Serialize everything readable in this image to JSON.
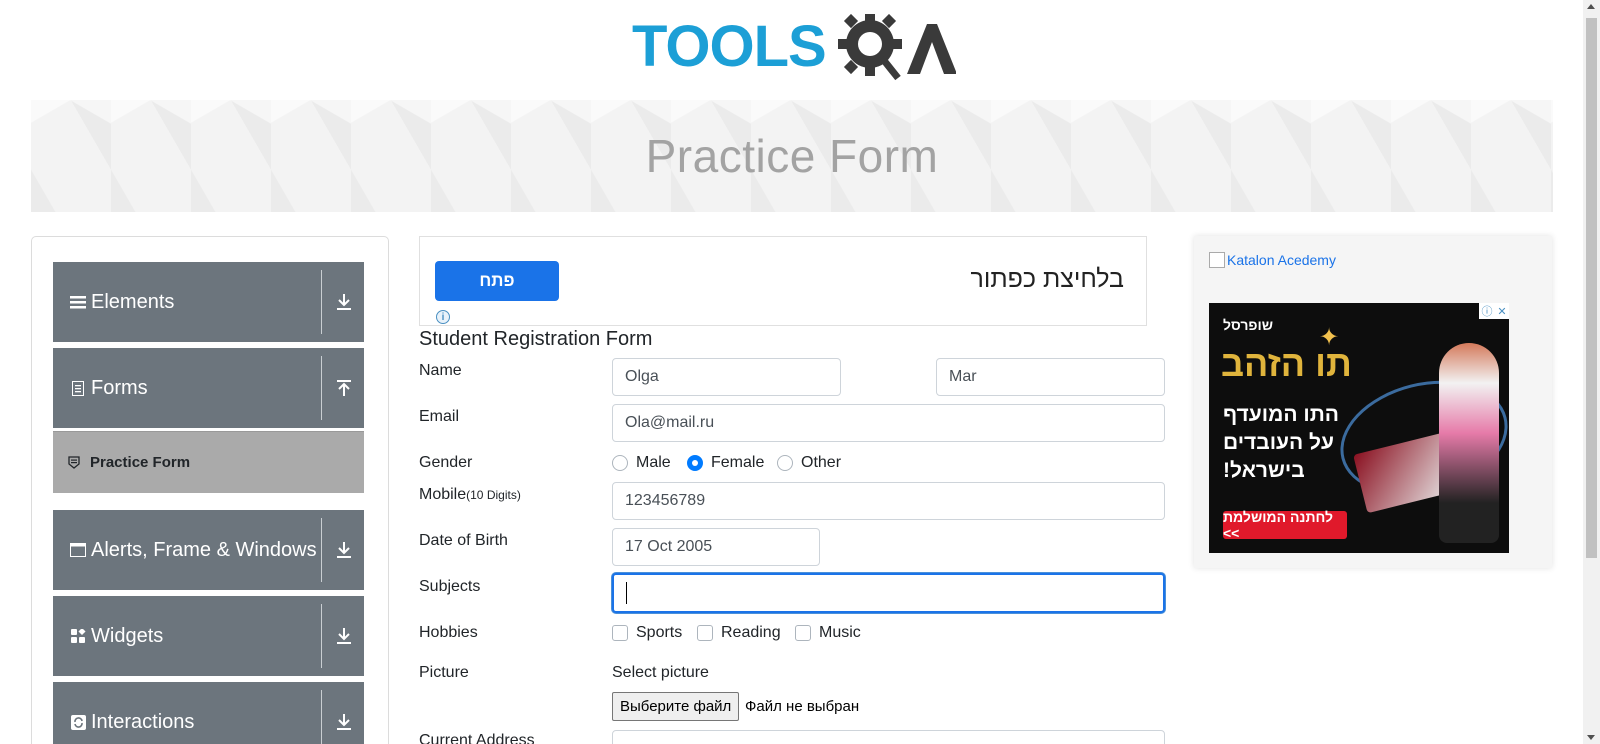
{
  "logo": {
    "part1": "TOOLS",
    "part2": "QA",
    "icon": "gear-magnifier-icon",
    "colors": {
      "primary": "#1c9fd6",
      "secondary": "#3a3a3a"
    }
  },
  "banner": {
    "title": "Practice Form"
  },
  "sidebar": {
    "groups": [
      {
        "label": "Elements",
        "icon": "hamburger-icon",
        "arrow": "download-arrow-icon"
      },
      {
        "label": "Forms",
        "icon": "document-icon",
        "arrow": "upload-arrow-icon"
      },
      {
        "label": "Alerts, Frame & Windows",
        "icon": "window-icon",
        "arrow": "download-arrow-icon"
      },
      {
        "label": "Widgets",
        "icon": "widgets-icon",
        "arrow": "download-arrow-icon"
      },
      {
        "label": "Interactions",
        "icon": "refresh-icon",
        "arrow": "download-arrow-icon"
      }
    ],
    "active_item": {
      "label": "Practice Form",
      "icon": "form-icon"
    },
    "colors": {
      "group_bg": "#6c757d",
      "active_bg": "#aaaaaa"
    }
  },
  "ad_top": {
    "button": "פתח",
    "text": "בלחיצת כפתור",
    "info": "i"
  },
  "form": {
    "title": "Student Registration Form",
    "name_label": "Name",
    "first_name": "Olga",
    "last_name": "Mar",
    "email_label": "Email",
    "email": "Ola@mail.ru",
    "gender_label": "Gender",
    "genders": [
      "Male",
      "Female",
      "Other"
    ],
    "gender_selected": "Female",
    "mobile_label": "Mobile",
    "mobile_hint": "(10 Digits)",
    "mobile": "123456789",
    "dob_label": "Date of Birth",
    "dob": "17 Oct 2005",
    "subjects_label": "Subjects",
    "subjects": "",
    "hobbies_label": "Hobbies",
    "hobbies": [
      "Sports",
      "Reading",
      "Music"
    ],
    "picture_label": "Picture",
    "picture_hint": "Select picture",
    "file_button": "Выберите файл",
    "file_status": "Файл не выбран",
    "address_label": "Current Address"
  },
  "ad_right": {
    "alt_link": "Katalon Acedemy",
    "brand": "שופרסל",
    "headline": "תו הזהב",
    "line1": "התו המועדף",
    "line2": "על העובדים",
    "line3": "בישראל!",
    "cta": "לחתנה המושלמת <<"
  }
}
